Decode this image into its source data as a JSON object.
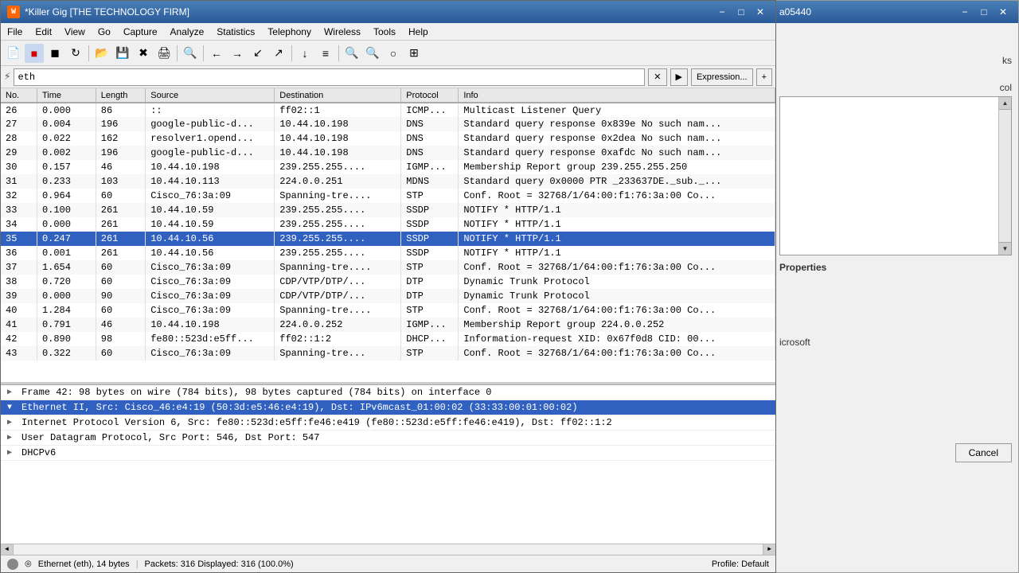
{
  "app": {
    "title": "*Killer Gig [THE TECHNOLOGY FIRM]",
    "icon": "W"
  },
  "background_window": {
    "title": "a05440",
    "sections": {
      "ks": "ks",
      "col": "col",
      "properties": "Properties",
      "microsoft": "icrosoft",
      "cancel": "Cancel"
    }
  },
  "menu": {
    "items": [
      "File",
      "Edit",
      "View",
      "Go",
      "Capture",
      "Analyze",
      "Statistics",
      "Telephony",
      "Wireless",
      "Tools",
      "Help"
    ]
  },
  "toolbar": {
    "buttons": [
      {
        "name": "new-capture",
        "icon": "📄"
      },
      {
        "name": "start-capture",
        "icon": "▶",
        "active": true
      },
      {
        "name": "stop-capture",
        "icon": "■",
        "active": false
      },
      {
        "name": "restart-capture",
        "icon": "↺"
      },
      {
        "name": "open-file",
        "icon": "📂"
      },
      {
        "name": "save-file",
        "icon": "💾"
      },
      {
        "name": "close-file",
        "icon": "✕"
      },
      {
        "name": "print",
        "icon": "🖨"
      },
      {
        "name": "find-packet",
        "icon": "🔍"
      },
      {
        "name": "go-back",
        "icon": "←"
      },
      {
        "name": "go-forward",
        "icon": "→"
      },
      {
        "name": "go-to-packet",
        "icon": "↙"
      },
      {
        "name": "go-first",
        "icon": "⇤"
      },
      {
        "name": "go-last",
        "icon": "⇥"
      },
      {
        "name": "autoscroll",
        "icon": "↓"
      },
      {
        "name": "colorize",
        "icon": "≡"
      },
      {
        "name": "zoom-in",
        "icon": "+"
      },
      {
        "name": "zoom-out",
        "icon": "-"
      },
      {
        "name": "zoom-reset",
        "icon": "○"
      },
      {
        "name": "resize-columns",
        "icon": "⊞"
      }
    ]
  },
  "filter": {
    "value": "eth",
    "placeholder": "eth",
    "expression_btn": "Expression...",
    "add_btn": "+"
  },
  "columns": {
    "no": "No.",
    "time": "Time",
    "length": "Length",
    "source": "Source",
    "destination": "Destination",
    "protocol": "Protocol",
    "info": "Info"
  },
  "packets": [
    {
      "no": "26",
      "time": "0.000",
      "length": "86",
      "source": "::",
      "destination": "ff02::1",
      "protocol": "ICMP...",
      "info": "Multicast Listener Query"
    },
    {
      "no": "27",
      "time": "0.004",
      "length": "196",
      "source": "google-public-d...",
      "destination": "10.44.10.198",
      "protocol": "DNS",
      "info": "Standard query response 0x839e No such nam..."
    },
    {
      "no": "28",
      "time": "0.022",
      "length": "162",
      "source": "resolver1.opend...",
      "destination": "10.44.10.198",
      "protocol": "DNS",
      "info": "Standard query response 0x2dea No such nam..."
    },
    {
      "no": "29",
      "time": "0.002",
      "length": "196",
      "source": "google-public-d...",
      "destination": "10.44.10.198",
      "protocol": "DNS",
      "info": "Standard query response 0xafdc No such nam..."
    },
    {
      "no": "30",
      "time": "0.157",
      "length": "46",
      "source": "10.44.10.198",
      "destination": "239.255.255....",
      "protocol": "IGMP...",
      "info": "Membership Report group 239.255.255.250"
    },
    {
      "no": "31",
      "time": "0.233",
      "length": "103",
      "source": "10.44.10.113",
      "destination": "224.0.0.251",
      "protocol": "MDNS",
      "info": "Standard query 0x0000 PTR _233637DE._sub._..."
    },
    {
      "no": "32",
      "time": "0.964",
      "length": "60",
      "source": "Cisco_76:3a:09",
      "destination": "Spanning-tre....",
      "protocol": "STP",
      "info": "Conf. Root = 32768/1/64:00:f1:76:3a:00  Co..."
    },
    {
      "no": "33",
      "time": "0.100",
      "length": "261",
      "source": "10.44.10.59",
      "destination": "239.255.255....",
      "protocol": "SSDP",
      "info": "NOTIFY * HTTP/1.1"
    },
    {
      "no": "34",
      "time": "0.000",
      "length": "261",
      "source": "10.44.10.59",
      "destination": "239.255.255....",
      "protocol": "SSDP",
      "info": "NOTIFY * HTTP/1.1"
    },
    {
      "no": "35",
      "time": "0.247",
      "length": "261",
      "source": "10.44.10.56",
      "destination": "239.255.255....",
      "protocol": "SSDP",
      "info": "NOTIFY * HTTP/1.1",
      "selected": true
    },
    {
      "no": "36",
      "time": "0.001",
      "length": "261",
      "source": "10.44.10.56",
      "destination": "239.255.255....",
      "protocol": "SSDP",
      "info": "NOTIFY * HTTP/1.1"
    },
    {
      "no": "37",
      "time": "1.654",
      "length": "60",
      "source": "Cisco_76:3a:09",
      "destination": "Spanning-tre....",
      "protocol": "STP",
      "info": "Conf. Root = 32768/1/64:00:f1:76:3a:00  Co..."
    },
    {
      "no": "38",
      "time": "0.720",
      "length": "60",
      "source": "Cisco_76:3a:09",
      "destination": "CDP/VTP/DTP/...",
      "protocol": "DTP",
      "info": "Dynamic Trunk Protocol"
    },
    {
      "no": "39",
      "time": "0.000",
      "length": "90",
      "source": "Cisco_76:3a:09",
      "destination": "CDP/VTP/DTP/...",
      "protocol": "DTP",
      "info": "Dynamic Trunk Protocol"
    },
    {
      "no": "40",
      "time": "1.284",
      "length": "60",
      "source": "Cisco_76:3a:09",
      "destination": "Spanning-tre....",
      "protocol": "STP",
      "info": "Conf. Root = 32768/1/64:00:f1:76:3a:00  Co..."
    },
    {
      "no": "41",
      "time": "0.791",
      "length": "46",
      "source": "10.44.10.198",
      "destination": "224.0.0.252",
      "protocol": "IGMP...",
      "info": "Membership Report group 224.0.0.252"
    },
    {
      "no": "42",
      "time": "0.890",
      "length": "98",
      "source": "fe80::523d:e5ff...",
      "destination": "ff02::1:2",
      "protocol": "DHCP...",
      "info": "Information-request XID: 0x67f0d8 CID: 00..."
    },
    {
      "no": "43",
      "time": "0.322",
      "length": "60",
      "source": "Cisco_76:3a:09",
      "destination": "Spanning-tre...",
      "protocol": "STP",
      "info": "Conf. Root = 32768/1/64:00:f1:76:3a:00  Co..."
    }
  ],
  "detail_items": [
    {
      "id": "frame",
      "text": "Frame 42: 98 bytes on wire (784 bits), 98 bytes captured (784 bits) on interface 0",
      "selected": false,
      "expanded": false
    },
    {
      "id": "ethernet",
      "text": "Ethernet II, Src: Cisco_46:e4:19 (50:3d:e5:46:e4:19), Dst: IPv6mcast_01:00:02 (33:33:00:01:00:02)",
      "selected": true,
      "expanded": true
    },
    {
      "id": "ipv6",
      "text": "Internet Protocol Version 6, Src: fe80::523d:e5ff:fe46:e419 (fe80::523d:e5ff:fe46:e419), Dst: ff02::1:2",
      "selected": false,
      "expanded": false
    },
    {
      "id": "udp",
      "text": "User Datagram Protocol, Src Port: 546, Dst Port: 547",
      "selected": false,
      "expanded": false
    },
    {
      "id": "dhcpv6",
      "text": "DHCPv6",
      "selected": false,
      "expanded": false
    }
  ],
  "status_bar": {
    "interface": "Ethernet (eth), 14 bytes",
    "stats": "Packets: 316  Displayed: 316 (100.0%)",
    "profile": "Profile: Default"
  }
}
